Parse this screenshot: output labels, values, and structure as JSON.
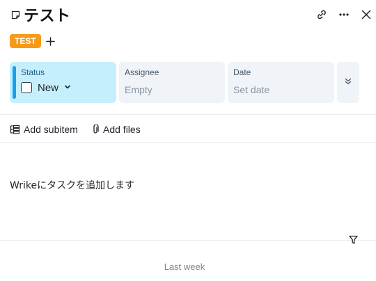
{
  "task": {
    "title": "テスト",
    "tag": "TEST",
    "tag_color": "#f79a17",
    "description": "Wrikeにタスクを追加します"
  },
  "header": {
    "icons": [
      "link-icon",
      "more-horizontal-icon",
      "close-icon"
    ]
  },
  "fields": {
    "status": {
      "label": "Status",
      "value": "New",
      "color": "#1aa0e6"
    },
    "assignee": {
      "label": "Assignee",
      "value": "Empty"
    },
    "date": {
      "label": "Date",
      "value": "Set date"
    }
  },
  "actions": {
    "add_subitem": "Add subitem",
    "add_files": "Add files"
  },
  "activity": {
    "period": "Last week"
  }
}
